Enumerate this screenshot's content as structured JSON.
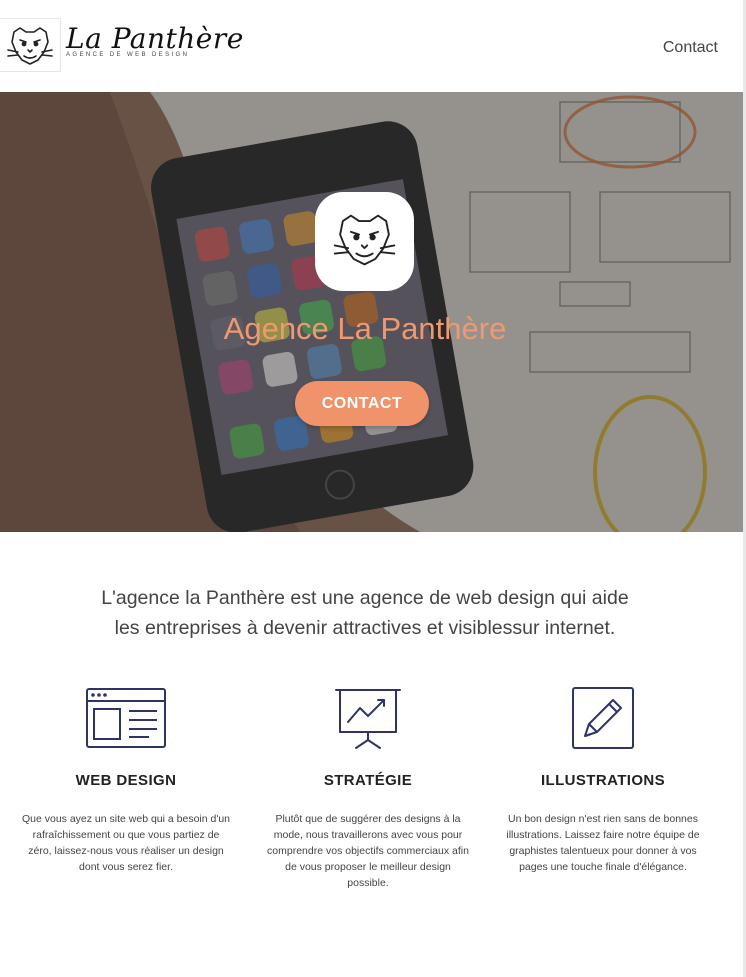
{
  "header": {
    "brand_name": "La Panthère",
    "brand_tagline": "AGENCE DE WEB DESIGN",
    "nav_contact": "Contact"
  },
  "hero": {
    "title": "Agence La Panthère",
    "cta_label": "CONTACT"
  },
  "intro": {
    "line1": "L'agence la Panthère est une agence de web design qui aide",
    "line2": "les entreprises à devenir attractives et visiblessur internet."
  },
  "features": [
    {
      "icon": "browser-layout-icon",
      "title": "WEB DESIGN",
      "text": "Que vous ayez un site web qui a besoin d'un rafraîchissement ou que vous partiez de zéro, laissez-nous vous réaliser un design dont vous serez fier."
    },
    {
      "icon": "presentation-chart-icon",
      "title": "STRATÉGIE",
      "text": "Plutôt que de suggérer des designs à la mode, nous travaillerons avec vous pour comprendre vos objectifs commerciaux afin de vous proposer le meilleur design possible."
    },
    {
      "icon": "pencil-icon",
      "title": "ILLUSTRATIONS",
      "text": "Un bon design n'est rien sans de bonnes illustrations. Laissez faire notre équipe de graphistes talentueux pour donner à vos pages une touche finale d'élégance."
    }
  ],
  "colors": {
    "accent": "#f0926a",
    "icon_stroke": "#2e3566",
    "text": "#444444"
  }
}
